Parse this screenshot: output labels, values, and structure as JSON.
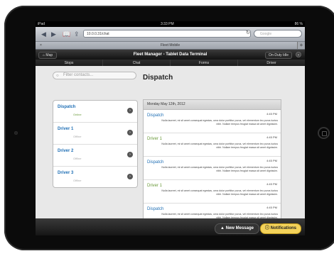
{
  "status": {
    "carrier": "iPad",
    "time": "3:33 PM",
    "battery": "86 %"
  },
  "browser": {
    "url": "10.0.0.31/chat",
    "search_placeholder": "Google",
    "tab_title": "Fleet Mobile",
    "tab_close": "×",
    "tab_add": "+"
  },
  "header": {
    "map_label": "Map",
    "title": "Fleet Manager - Tablet Data Terminal",
    "duty_label": "On-Duty Idle"
  },
  "nav": [
    "Stops",
    "Chat",
    "Forms",
    "Driver"
  ],
  "filter": {
    "placeholder": "Filter contacts..."
  },
  "contacts": [
    {
      "name": "Dispatch",
      "status": "Online",
      "color": "#1f6fb5",
      "status_color": "#6a9a3a"
    },
    {
      "name": "Driver 1",
      "status": "Offline",
      "color": "#1f6fb5",
      "status_color": "#aaaaaa"
    },
    {
      "name": "Driver 2",
      "status": "Offline",
      "color": "#1f6fb5",
      "status_color": "#aaaaaa"
    },
    {
      "name": "Driver 3",
      "status": "Offline",
      "color": "#1f6fb5",
      "status_color": "#aaaaaa"
    }
  ],
  "panel": {
    "title": "Dispatch",
    "date": "Monday May 12th, 2012"
  },
  "messages": [
    {
      "sender": "Dispatch",
      "time": "4:45 PM",
      "color": "#1f6fb5",
      "body": "Nulla laoreet, mi sit amet consequat egestas, urna dolor porttitor purus, vel elementum leo purus luctus nibh. Nullam tempus feugiat massa sit amet dignissim."
    },
    {
      "sender": "Driver 1",
      "time": "4:45 PM",
      "color": "#6a9a3a",
      "body": "Nulla laoreet, mi sit amet consequat egestas, urna dolor porttitor purus, vel elementum leo purus luctus nibh. Nullam tempus feugiat massa sit amet dignissim."
    },
    {
      "sender": "Dispatch",
      "time": "4:45 PM",
      "color": "#1f6fb5",
      "body": "Nulla laoreet, mi sit amet consequat egestas, urna dolor porttitor purus, vel elementum leo purus luctus nibh. Nullam tempus feugiat massa sit amet dignissim."
    },
    {
      "sender": "Driver 1",
      "time": "4:45 PM",
      "color": "#6a9a3a",
      "body": "Nulla laoreet, mi sit amet consequat egestas, urna dolor porttitor purus, vel elementum leo purus luctus nibh. Nullam tempus feugiat massa sit amet dignissim."
    },
    {
      "sender": "Dispatch",
      "time": "4:45 PM",
      "color": "#1f6fb5",
      "body": "Nulla laoreet, mi sit amet consequat egestas, urna dolor porttitor purus, vel elementum leo purus luctus nibh. Nullam tempus feugiat massa sit amet dignissim."
    }
  ],
  "footer": {
    "new_message": "New Message",
    "notifications": "Notifications"
  },
  "icons": {
    "back": "back-arrow-icon",
    "forward": "forward-arrow-icon",
    "bookmarks": "book-icon",
    "share": "share-icon",
    "reload": "reload-icon",
    "search": "search-icon",
    "map": "home-icon",
    "duty": "chevron-down-icon",
    "chevron": "chevron-right-icon",
    "new_message": "arrow-up-icon",
    "notifications": "info-icon"
  }
}
